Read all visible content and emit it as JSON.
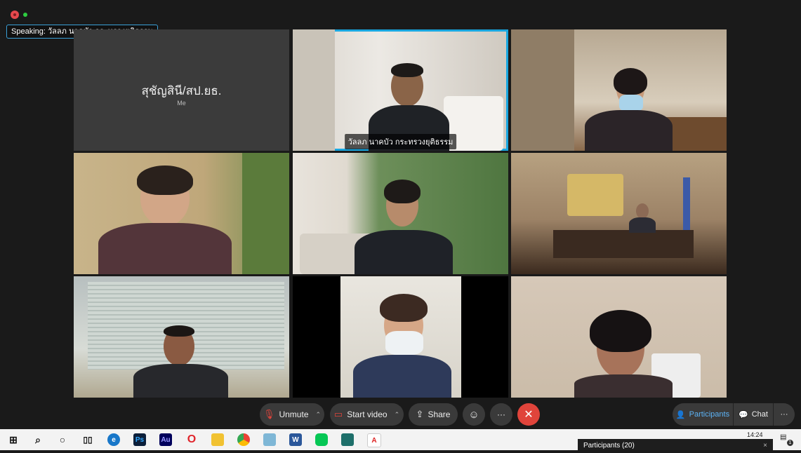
{
  "window": {
    "close_color": "#e5484d",
    "status_color": "#2ecc40"
  },
  "speaking_banner": "Speaking: วัลลภ นาคบัว กระทรวงยุติธรรม",
  "self_tile": {
    "name": "สุชัญสินี/สป.ยธ.",
    "label": "Me"
  },
  "active_speaker": {
    "name": "วัลลภ นาคบัว กระทรวงยุติธรรม",
    "highlight_color": "#19a7e0"
  },
  "controls": {
    "unmute": "Unmute",
    "start_video": "Start video",
    "share": "Share",
    "reactions_icon": "smile-icon",
    "more": "···",
    "end_icon": "close-icon",
    "end_color": "#e0443b",
    "participants": "Participants",
    "chat": "Chat",
    "more_side": "···"
  },
  "participants_popup": {
    "title": "Participants (20)"
  },
  "taskbar": {
    "clock": "14:24",
    "notification_count": "1",
    "apps": [
      "windows-start",
      "search",
      "cortana",
      "task-view",
      "edge",
      "photoshop",
      "audition",
      "opera",
      "file-explorer",
      "chrome",
      "app",
      "word",
      "line",
      "app",
      "acrobat"
    ],
    "labels": {
      "ps": "Ps",
      "au": "Au",
      "word": "W"
    }
  }
}
